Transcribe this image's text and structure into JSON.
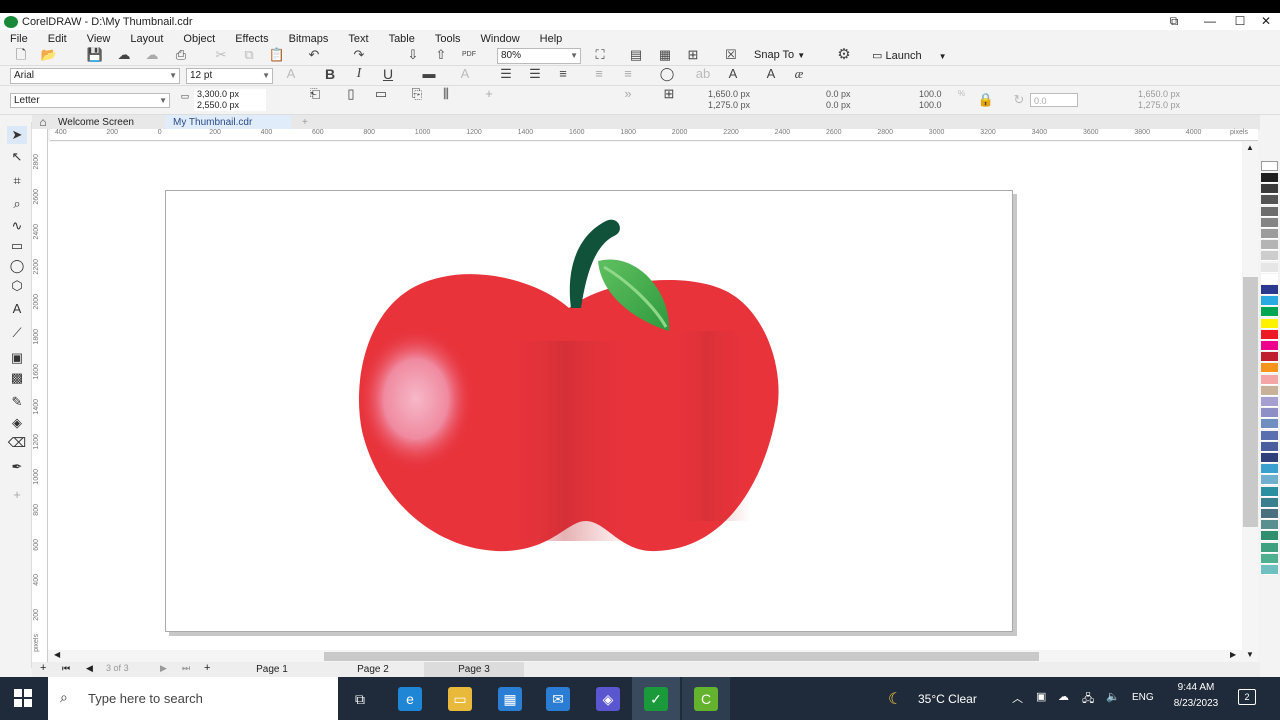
{
  "app": {
    "title": "CorelDRAW - D:\\My Thumbnail.cdr"
  },
  "window_controls": {
    "restore": "⧉",
    "minimize": "—",
    "maximize": "☐",
    "close": "✕"
  },
  "menu": [
    "File",
    "Edit",
    "View",
    "Layout",
    "Object",
    "Effects",
    "Bitmaps",
    "Text",
    "Table",
    "Tools",
    "Window",
    "Help"
  ],
  "std_toolbar": {
    "zoom": "80%",
    "snap_to": "Snap To",
    "launch": "Launch",
    "pdf": "PDF"
  },
  "text_toolbar": {
    "font": "Arial",
    "size": "12 pt",
    "bold": "B",
    "italic": "I",
    "underline": "U"
  },
  "property_bar": {
    "paper": "Letter",
    "width": "3,300.0 px",
    "height": "2,550.0 px",
    "x": "1,650.0 px",
    "y": "1,275.0 px",
    "nudge_x": "0.0 px",
    "nudge_y": "0.0 px",
    "scale_x": "100.0",
    "scale_y": "100.0",
    "pct": "%",
    "angle": "0.0",
    "size_w": "1,650.0 px",
    "size_h": "1,275.0 px"
  },
  "doc_tabs": {
    "welcome": "Welcome Screen",
    "current": "My Thumbnail.cdr",
    "add": "+"
  },
  "ruler": {
    "h_ticks": [
      "400",
      "200",
      "0",
      "200",
      "400",
      "600",
      "800",
      "1000",
      "1200",
      "1400",
      "1600",
      "1800",
      "2000",
      "2200",
      "2400",
      "2600",
      "2800",
      "3000",
      "3200",
      "3400",
      "3600",
      "3800",
      "4000"
    ],
    "unit": "pixels",
    "v_ticks": [
      "2800",
      "2600",
      "2400",
      "2200",
      "2000",
      "1800",
      "1600",
      "1400",
      "1200",
      "1000",
      "800",
      "600",
      "400",
      "200"
    ],
    "v_unit": "pixels"
  },
  "page_nav": {
    "counter_current": "3",
    "counter_of": "of",
    "counter_total": "3",
    "pages": [
      "Page 1",
      "Page 2",
      "Page 3"
    ]
  },
  "palette": [
    "#1e1e1e",
    "#3a3a3a",
    "#555555",
    "#6d6d6d",
    "#858585",
    "#9c9c9c",
    "#b4b4b4",
    "#cdcdcd",
    "#e6e6e6",
    "#ffffff",
    "#2b3990",
    "#29abe2",
    "#00a651",
    "#fff200",
    "#ed1c24",
    "#ec008c",
    "#be1e2d",
    "#f7941d",
    "#f4a6a6",
    "#c7b299",
    "#a5a0d0",
    "#8f8fc7",
    "#6f8fc0",
    "#5a6fb0",
    "#4a5e9e",
    "#2e3f7a",
    "#3aa0d0",
    "#6fb0d0",
    "#2a8fa0",
    "#3a7f8f",
    "#4a6f7f",
    "#5a8f8f",
    "#2f8f6f",
    "#3fa07f",
    "#4fb08f",
    "#6fc0c0"
  ],
  "taskbar": {
    "search_placeholder": "Type here to search",
    "weather": "35°C  Clear",
    "lang": "ENG",
    "time": "9:44 AM",
    "date": "8/23/2023",
    "notif": "2"
  }
}
